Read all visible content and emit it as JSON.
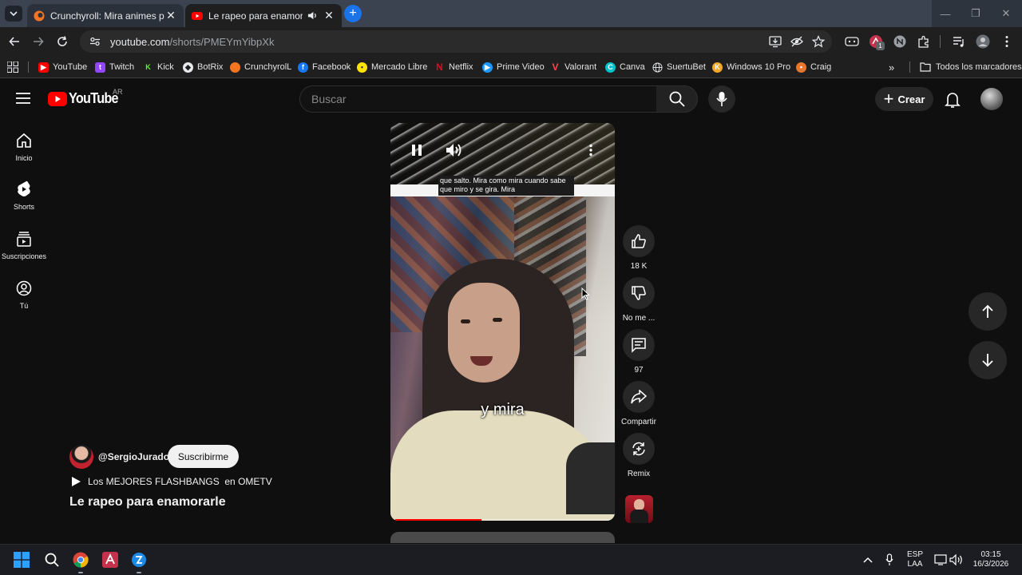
{
  "browser": {
    "tabs": [
      {
        "title": "Crunchyroll: Mira animes popul",
        "active": false
      },
      {
        "title": "Le rapeo para enamorarle -",
        "active": true
      }
    ],
    "url_host": "youtube.com",
    "url_path": "/shorts/PMEYmYibpXk",
    "bookmarks": [
      {
        "label": "YouTube",
        "color": "#ff0000",
        "icon": "youtube-icon"
      },
      {
        "label": "Twitch",
        "color": "#9146ff",
        "icon": "twitch-icon"
      },
      {
        "label": "Kick",
        "color": "#53fc18",
        "icon": "kick-icon"
      },
      {
        "label": "BotRix",
        "color": "#333333",
        "icon": "botrix-icon"
      },
      {
        "label": "CrunchyrolL",
        "color": "#f47521",
        "icon": "crunchyroll-icon"
      },
      {
        "label": "Facebook",
        "color": "#1877f2",
        "icon": "facebook-icon"
      },
      {
        "label": "Mercado Libre",
        "color": "#ffe600",
        "icon": "mercadolibre-icon"
      },
      {
        "label": "Netflix",
        "color": "#e50914",
        "icon": "netflix-icon"
      },
      {
        "label": "Prime Video",
        "color": "#1a98ff",
        "icon": "primevideo-icon"
      },
      {
        "label": "Valorant",
        "color": "#ff4655",
        "icon": "valorant-icon"
      },
      {
        "label": "Canva",
        "color": "#00c4cc",
        "icon": "canva-icon"
      },
      {
        "label": "SuertuBet",
        "color": "#5f6368",
        "icon": "globe-icon"
      },
      {
        "label": "Windows 10 Pro",
        "color": "#f5a623",
        "icon": "windows-key-icon"
      },
      {
        "label": "Craig",
        "color": "#e8772e",
        "icon": "craig-icon"
      }
    ],
    "all_bookmarks_label": "Todos los marcadores",
    "extension_badge": "1"
  },
  "youtube": {
    "logo_text": "YouTube",
    "country_code": "AR",
    "search_placeholder": "Buscar",
    "create_label": "Crear",
    "guide": [
      {
        "label": "Inicio",
        "icon": "home-icon"
      },
      {
        "label": "Shorts",
        "icon": "shorts-icon"
      },
      {
        "label": "Suscripciones",
        "icon": "subscriptions-icon"
      },
      {
        "label": "Tú",
        "icon": "you-icon"
      }
    ],
    "short": {
      "caption": "que salto. Mira como mira cuando sabe que miro y se gira. Mira",
      "subtitle": "y mira",
      "progress": 0.4,
      "channel": "@SergioJurado",
      "subscribe_label": "Suscribirme",
      "playlist": "Los MEJORES FLASHBANGS  en OMETV",
      "title": "Le rapeo para enamorarle"
    },
    "actions": {
      "like": "18 K",
      "dislike": "No me ...",
      "comments": "97",
      "share": "Compartir",
      "remix": "Remix"
    }
  },
  "taskbar": {
    "lang_top": "ESP",
    "lang_bottom": "LAA",
    "time": "03:15",
    "date": "16/3/2026"
  },
  "colors": {
    "youtube_red": "#ff0000",
    "background": "#0f0f0f",
    "chrome_accent": "#1a73e8"
  }
}
